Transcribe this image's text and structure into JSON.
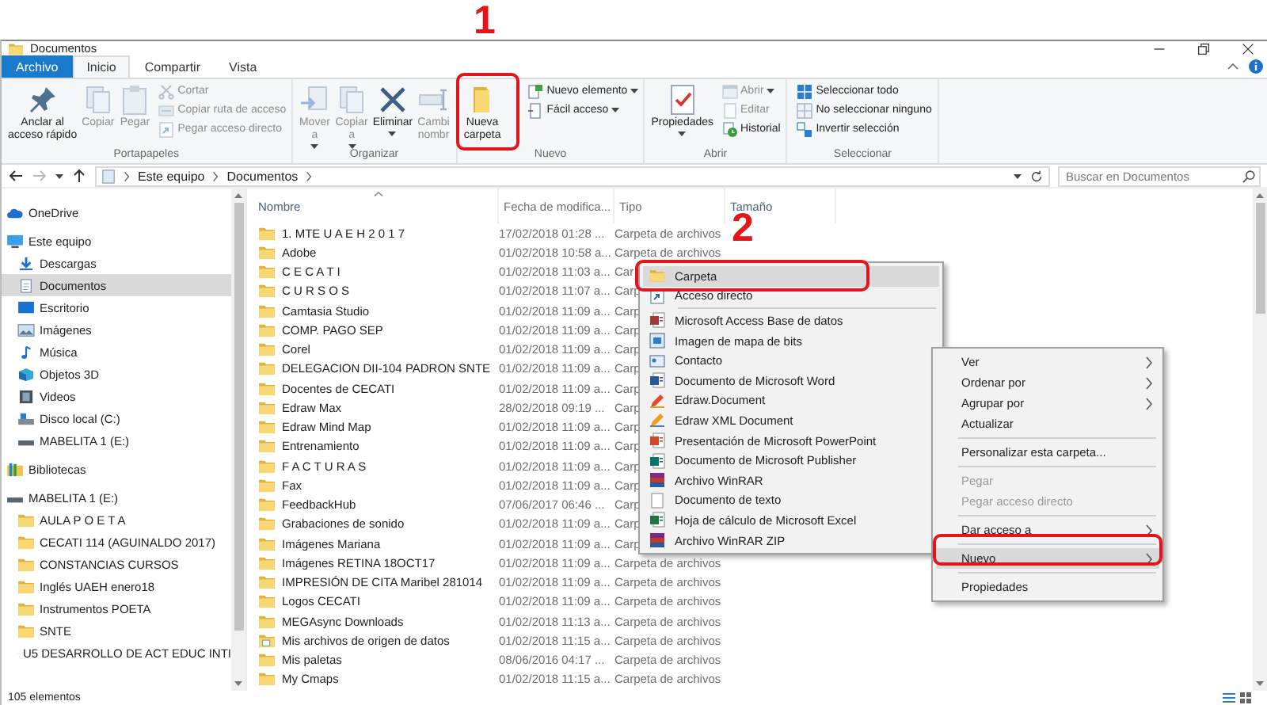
{
  "title_bar": {
    "title": "Documentos"
  },
  "ribbon_tabs": [
    {
      "label": "Archivo",
      "kind": "file",
      "selected": false
    },
    {
      "label": "Inicio",
      "kind": "tab",
      "selected": true
    },
    {
      "label": "Compartir",
      "kind": "tab",
      "selected": false
    },
    {
      "label": "Vista",
      "kind": "tab",
      "selected": false
    }
  ],
  "ribbon_groups": [
    {
      "label": "Portapapeles",
      "commands": [
        {
          "label": "Anclar al\nacceso rápido",
          "kind": "large",
          "disabled": false,
          "dropdown": false
        },
        {
          "label": "Copiar",
          "kind": "large",
          "disabled": true,
          "dropdown": false
        },
        {
          "label": "Pegar",
          "kind": "large",
          "disabled": true,
          "dropdown": false
        },
        {
          "label": "Cortar",
          "kind": "small",
          "disabled": true,
          "dropdown": false
        },
        {
          "label": "Copiar ruta de acceso",
          "kind": "small",
          "disabled": true,
          "dropdown": false
        },
        {
          "label": "Pegar acceso directo",
          "kind": "small",
          "disabled": true,
          "dropdown": false
        }
      ]
    },
    {
      "label": "Organizar",
      "commands": [
        {
          "label": "Mover\na",
          "kind": "large",
          "disabled": true,
          "dropdown": true
        },
        {
          "label": "Copiar\na",
          "kind": "large",
          "disabled": true,
          "dropdown": true
        },
        {
          "label": "Eliminar",
          "kind": "large",
          "disabled": false,
          "dropdown": true
        },
        {
          "label": "Cambi\nnombr",
          "kind": "large",
          "disabled": true,
          "dropdown": false
        }
      ]
    },
    {
      "label": "Nuevo",
      "commands": [
        {
          "label": "Nueva\ncarpeta",
          "kind": "large",
          "disabled": false,
          "dropdown": false
        },
        {
          "label": "Nuevo elemento",
          "kind": "small",
          "disabled": false,
          "dropdown": true
        },
        {
          "label": "Fácil acceso",
          "kind": "small",
          "disabled": false,
          "dropdown": true
        }
      ]
    },
    {
      "label": "Abrir",
      "commands": [
        {
          "label": "Propiedades",
          "kind": "large",
          "disabled": false,
          "dropdown": true
        },
        {
          "label": "Abrir",
          "kind": "small",
          "disabled": true,
          "dropdown": true
        },
        {
          "label": "Editar",
          "kind": "small",
          "disabled": true,
          "dropdown": false
        },
        {
          "label": "Historial",
          "kind": "small",
          "disabled": false,
          "dropdown": false
        }
      ]
    },
    {
      "label": "Seleccionar",
      "commands": [
        {
          "label": "Seleccionar todo",
          "kind": "small",
          "disabled": false,
          "dropdown": false
        },
        {
          "label": "No seleccionar ninguno",
          "kind": "small",
          "disabled": false,
          "dropdown": false
        },
        {
          "label": "Invertir selección",
          "kind": "small",
          "disabled": false,
          "dropdown": false
        }
      ]
    }
  ],
  "address_bar": {
    "path": [
      "Este equipo",
      "Documentos"
    ]
  },
  "search": {
    "placeholder": "Buscar en Documentos"
  },
  "navigation": [
    {
      "label": "OneDrive",
      "selected": false
    },
    {
      "label": "Este equipo",
      "selected": false,
      "children": [
        {
          "label": "Descargas",
          "selected": false
        },
        {
          "label": "Documentos",
          "selected": true
        },
        {
          "label": "Escritorio",
          "selected": false
        },
        {
          "label": "Imágenes",
          "selected": false
        },
        {
          "label": "Música",
          "selected": false
        },
        {
          "label": "Objetos 3D",
          "selected": false
        },
        {
          "label": "Videos",
          "selected": false
        },
        {
          "label": "Disco local (C:)",
          "selected": false
        },
        {
          "label": "MABELITA 1 (E:)",
          "selected": false
        }
      ]
    },
    {
      "label": "Bibliotecas",
      "selected": false
    },
    {
      "label": "MABELITA 1 (E:)",
      "selected": false,
      "children": [
        {
          "label": "AULA P O E T A",
          "selected": false
        },
        {
          "label": "CECATI 114 (AGUINALDO 2017)",
          "selected": false
        },
        {
          "label": "CONSTANCIAS CURSOS",
          "selected": false
        },
        {
          "label": "Inglés UAEH enero18",
          "selected": false
        },
        {
          "label": "Instrumentos POETA",
          "selected": false
        },
        {
          "label": "SNTE",
          "selected": false
        },
        {
          "label": "U5 DESARROLLO DE ACT EDUC INTI",
          "selected": false
        }
      ]
    }
  ],
  "file_list": {
    "columns": [
      "Nombre",
      "Fecha de modifica...",
      "Tipo",
      "Tamaño"
    ],
    "rows": [
      {
        "name": "1. MTE U A E H  2 0 1 7",
        "modified": "17/02/2018 01:28 ...",
        "type": "Carpeta de archivos"
      },
      {
        "name": "Adobe",
        "modified": "01/02/2018 10:58 a...",
        "type": "Carpeta de archivos"
      },
      {
        "name": "C E C A T I",
        "modified": "01/02/2018 11:03 a...",
        "type": "Car"
      },
      {
        "name": "C U R S O S",
        "modified": "01/02/2018 11:07 a...",
        "type": "Carp"
      },
      {
        "name": "Camtasia Studio",
        "modified": "01/02/2018 11:09 a...",
        "type": "Carp"
      },
      {
        "name": "COMP. PAGO SEP",
        "modified": "01/02/2018 11:09 a...",
        "type": "Carp"
      },
      {
        "name": "Corel",
        "modified": "01/02/2018 11:09 a...",
        "type": "Carp"
      },
      {
        "name": "DELEGACION DII-104 PADRON SNTE",
        "modified": "01/02/2018 11:09 a...",
        "type": "Carp"
      },
      {
        "name": "Docentes de CECATI",
        "modified": "01/02/2018 11:09 a...",
        "type": "Carp"
      },
      {
        "name": "Edraw Max",
        "modified": "28/02/2018 09:19 ...",
        "type": "Carp"
      },
      {
        "name": "Edraw Mind Map",
        "modified": "01/02/2018 11:09 a...",
        "type": "Carp"
      },
      {
        "name": "Entrenamiento",
        "modified": "01/02/2018 11:09 a...",
        "type": "Carp"
      },
      {
        "name": "F A C T U R A S",
        "modified": "01/02/2018 11:09 a...",
        "type": "Carp"
      },
      {
        "name": "Fax",
        "modified": "01/02/2018 11:09 a...",
        "type": "Carp"
      },
      {
        "name": "FeedbackHub",
        "modified": "07/06/2017 06:46 ...",
        "type": "Carp"
      },
      {
        "name": "Grabaciones de sonido",
        "modified": "01/02/2018 11:09 a...",
        "type": "Carp"
      },
      {
        "name": "Imágenes Mariana",
        "modified": "01/02/2018 11:09 a...",
        "type": "Carp"
      },
      {
        "name": "Imágenes RETINA 18OCT17",
        "modified": "01/02/2018 11:09 a...",
        "type": "Carpeta de archivos"
      },
      {
        "name": "IMPRESIÓN DE CITA Maribel 281014",
        "modified": "01/02/2018 11:09 a...",
        "type": "Carpeta de archivos"
      },
      {
        "name": "Logos CECATI",
        "modified": "01/02/2018 11:09 a...",
        "type": "Carpeta de archivos"
      },
      {
        "name": "MEGAsync Downloads",
        "modified": "01/02/2018 11:13 a...",
        "type": "Carpeta de archivos"
      },
      {
        "name": "Mis archivos de origen de datos",
        "modified": "01/02/2018 11:15 a...",
        "type": "Carpeta de archivos"
      },
      {
        "name": "Mis paletas",
        "modified": "08/06/2016 04:17 ...",
        "type": "Carpeta de archivos"
      },
      {
        "name": "My Cmaps",
        "modified": "01/02/2018 11:15 a...",
        "type": "Carpeta de archivos"
      }
    ]
  },
  "status_bar": {
    "count": "105 elementos"
  },
  "new_submenu": [
    {
      "kind": "item",
      "label": "Carpeta",
      "selected": true
    },
    {
      "kind": "item",
      "label": "Acceso directo",
      "selected": false
    },
    {
      "kind": "separator"
    },
    {
      "kind": "item",
      "label": "Microsoft Access Base de datos",
      "selected": false
    },
    {
      "kind": "item",
      "label": "Imagen de mapa de bits",
      "selected": false
    },
    {
      "kind": "item",
      "label": "Contacto",
      "selected": false
    },
    {
      "kind": "item",
      "label": "Documento de Microsoft Word",
      "selected": false
    },
    {
      "kind": "item",
      "label": "Edraw.Document",
      "selected": false
    },
    {
      "kind": "item",
      "label": "Edraw XML Document",
      "selected": false
    },
    {
      "kind": "item",
      "label": "Presentación de Microsoft PowerPoint",
      "selected": false
    },
    {
      "kind": "item",
      "label": "Documento de Microsoft Publisher",
      "selected": false
    },
    {
      "kind": "item",
      "label": "Archivo WinRAR",
      "selected": false
    },
    {
      "kind": "item",
      "label": "Documento de texto",
      "selected": false
    },
    {
      "kind": "item",
      "label": "Hoja de cálculo de Microsoft Excel",
      "selected": false
    },
    {
      "kind": "item",
      "label": "Archivo WinRAR ZIP",
      "selected": false
    }
  ],
  "context_menu": [
    {
      "kind": "item",
      "label": "Ver",
      "submenu": true,
      "disabled": false,
      "selected": false
    },
    {
      "kind": "item",
      "label": "Ordenar por",
      "submenu": true,
      "disabled": false,
      "selected": false
    },
    {
      "kind": "item",
      "label": "Agrupar por",
      "submenu": true,
      "disabled": false,
      "selected": false
    },
    {
      "kind": "item",
      "label": "Actualizar",
      "submenu": false,
      "disabled": false,
      "selected": false
    },
    {
      "kind": "separator"
    },
    {
      "kind": "item",
      "label": "Personalizar esta carpeta...",
      "submenu": false,
      "disabled": false,
      "selected": false
    },
    {
      "kind": "separator"
    },
    {
      "kind": "item",
      "label": "Pegar",
      "submenu": false,
      "disabled": true,
      "selected": false
    },
    {
      "kind": "item",
      "label": "Pegar acceso directo",
      "submenu": false,
      "disabled": true,
      "selected": false
    },
    {
      "kind": "separator"
    },
    {
      "kind": "item",
      "label": "Dar acceso a",
      "submenu": true,
      "disabled": false,
      "selected": false
    },
    {
      "kind": "separator"
    },
    {
      "kind": "item",
      "label": "Nuevo",
      "submenu": true,
      "disabled": false,
      "selected": true
    },
    {
      "kind": "separator"
    },
    {
      "kind": "item",
      "label": "Propiedades",
      "submenu": false,
      "disabled": false,
      "selected": false
    }
  ],
  "annotations": [
    {
      "kind": "number",
      "text": "1"
    },
    {
      "kind": "frame"
    },
    {
      "kind": "number",
      "text": "2"
    },
    {
      "kind": "frame"
    },
    {
      "kind": "frame"
    }
  ]
}
